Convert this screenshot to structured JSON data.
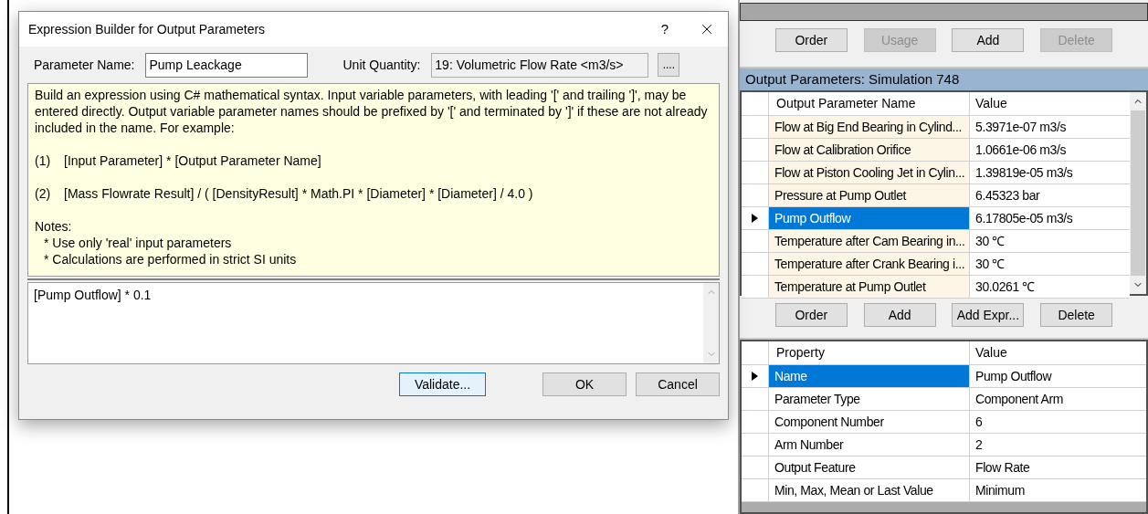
{
  "dialog": {
    "title": "Expression Builder for Output Parameters",
    "help_button": "?",
    "parameter_name": {
      "label": "Parameter Name:",
      "value": "Pump Leackage"
    },
    "unit_quantity": {
      "label": "Unit Quantity:",
      "value": "19: Volumetric Flow Rate <m3/s>",
      "browse_button": "...."
    },
    "help_text": {
      "intro": "Build an expression using C# mathematical syntax. Input variable parameters, with leading '[' and trailing ']', may be entered directly. Output variable parameter names should be prefixed by '[' and terminated by ']' if these are not already included in the name. For example:",
      "examples": [
        {
          "number": "(1)",
          "text": "[Input Parameter] * [Output Parameter Name]"
        },
        {
          "number": "(2)",
          "text": "[Mass Flowrate Result] / ( [DensityResult] * Math.PI * [Diameter] * [Diameter] / 4.0 )"
        }
      ],
      "notes_title": "Notes:",
      "notes": [
        "* Use only 'real' input parameters",
        "* Calculations are performed in strict SI units"
      ]
    },
    "expression": "[Pump Outflow] * 0.1",
    "buttons": [
      {
        "label": "Validate...",
        "focused": true
      },
      {
        "label": "OK",
        "focused": false
      },
      {
        "label": "Cancel",
        "focused": false
      }
    ]
  },
  "top_buttons": [
    {
      "label": "Order",
      "disabled": false
    },
    {
      "label": "Usage",
      "disabled": true
    },
    {
      "label": "Add",
      "disabled": false
    },
    {
      "label": "Delete",
      "disabled": true
    }
  ],
  "output_parameters": {
    "title": "Output Parameters: Simulation 748",
    "columns": [
      "Output Parameter Name",
      "Value"
    ],
    "rows": [
      {
        "name": "Flow at Big End Bearing in Cylind...",
        "value": "5.3971e-07 m3/s",
        "selected": false
      },
      {
        "name": "Flow at Calibration Orifice",
        "value": "1.0661e-06 m3/s",
        "selected": false
      },
      {
        "name": "Flow at Piston Cooling Jet in Cylin...",
        "value": "1.39819e-05 m3/s",
        "selected": false
      },
      {
        "name": "Pressure at Pump Outlet",
        "value": "6.45323 bar",
        "selected": false
      },
      {
        "name": "Pump Outflow",
        "value": "6.17805e-05 m3/s",
        "selected": true
      },
      {
        "name": "Temperature after Cam Bearing in...",
        "value": "30 ℃",
        "selected": false
      },
      {
        "name": "Temperature after Crank Bearing i...",
        "value": "30 ℃",
        "selected": false
      },
      {
        "name": "Temperature at Pump Outlet",
        "value": "30.0261 ℃",
        "selected": false
      }
    ]
  },
  "bottom_buttons": [
    {
      "label": "Order",
      "disabled": false
    },
    {
      "label": "Add",
      "disabled": false
    },
    {
      "label": "Add Expr...",
      "disabled": false
    },
    {
      "label": "Delete",
      "disabled": false
    }
  ],
  "properties": {
    "columns": [
      "Property",
      "Value"
    ],
    "rows": [
      {
        "property": "Name",
        "value": "Pump Outflow",
        "selected": true
      },
      {
        "property": "Parameter Type",
        "value": "Component Arm",
        "selected": false
      },
      {
        "property": "Component Number",
        "value": "6",
        "selected": false
      },
      {
        "property": "Arm Number",
        "value": "2",
        "selected": false
      },
      {
        "property": "Output Feature",
        "value": "Flow Rate",
        "selected": false
      },
      {
        "property": "Min, Max, Mean or Last Value",
        "value": "Minimum",
        "selected": false
      }
    ]
  }
}
